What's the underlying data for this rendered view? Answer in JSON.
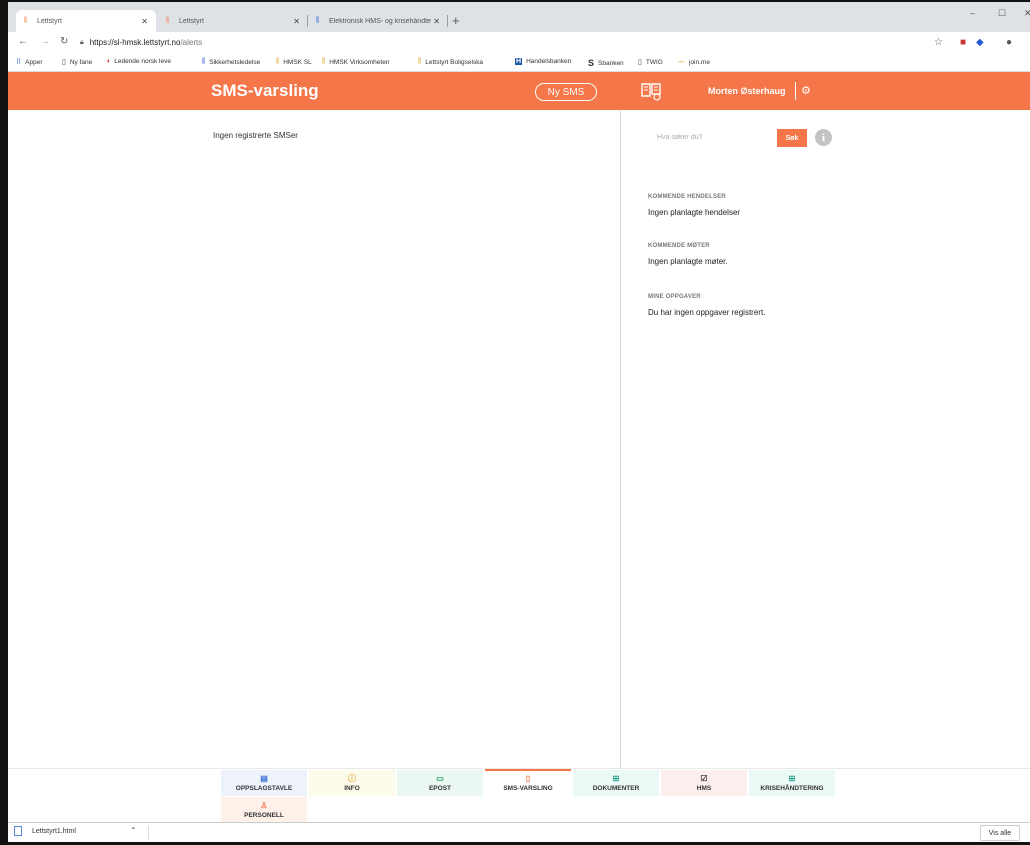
{
  "browser": {
    "tabs": [
      {
        "title": "Lettstyrt",
        "active": true
      },
      {
        "title": "Lettstyrt",
        "active": false
      },
      {
        "title": "Elektronisk HMS- og krisehåndte",
        "active": false
      }
    ],
    "new_tab": "+",
    "window_controls": {
      "minimize": "–",
      "maximize": "☐",
      "close": "✕"
    },
    "url_host": "https://sl-hmsk.lettstyrt.no",
    "url_path": "/alerts",
    "bookmarks": [
      {
        "label": "Apper",
        "icon": "apps-grid-icon"
      },
      {
        "label": "Ny fane",
        "icon": "page-icon"
      },
      {
        "label": "Ledende norsk leve",
        "icon": "lips-icon"
      },
      {
        "label": "Sikkerhetsledelse",
        "icon": "lettstyrt-icon"
      },
      {
        "label": "HMSK SL",
        "icon": "lettstyrt-icon"
      },
      {
        "label": "HMSK Virksomheten",
        "icon": "lettstyrt-icon"
      },
      {
        "label": "Lettstyrt Boligselska",
        "icon": "lettstyrt-icon"
      },
      {
        "label": "Handelsbanken",
        "icon": "handelsbanken-icon"
      },
      {
        "label": "Sbanken",
        "icon": "sbanken-icon"
      },
      {
        "label": "TWIG",
        "icon": "page-icon"
      },
      {
        "label": "join.me",
        "icon": "joinme-icon"
      }
    ]
  },
  "header": {
    "title": "SMS-varsling",
    "new_sms_label": "Ny SMS",
    "user_name": "Morten Østerhaug"
  },
  "main": {
    "empty_message": "Ingen registrerte SMSer"
  },
  "side": {
    "search_placeholder": "Hva søker du?",
    "search_button": "Søk",
    "info_glyph": "i",
    "sections": [
      {
        "title": "KOMMENDE HENDELSER",
        "text": "Ingen planlagte hendelser"
      },
      {
        "title": "KOMMENDE MØTER",
        "text": "Ingen planlagte møter."
      },
      {
        "title": "MINE OPPGAVER",
        "text": "Du har ingen oppgaver registrert."
      }
    ]
  },
  "bottom_nav": [
    {
      "label": "OPPSLAGSTAVLE",
      "icon": "board-icon",
      "bg": "#eef3fb",
      "color": "#3b6fd6"
    },
    {
      "label": "INFO",
      "icon": "info-circle-icon",
      "bg": "#fdfbec",
      "color": "#e0a92a"
    },
    {
      "label": "EPOST",
      "icon": "chat-icon",
      "bg": "#eaf8f1",
      "color": "#2a9d68"
    },
    {
      "label": "SMS-VARSLING",
      "icon": "phone-icon",
      "bg": "#ffffff",
      "color": "#f47649",
      "active": true
    },
    {
      "label": "DOKUMENTER",
      "icon": "documents-icon",
      "bg": "#eaf8f6",
      "color": "#2a9d90"
    },
    {
      "label": "HMS",
      "icon": "checklist-icon",
      "bg": "#fdeeee",
      "color": "#444444"
    },
    {
      "label": "KRISEHÅNDTERING",
      "icon": "crisis-icon",
      "bg": "#eaf8f6",
      "color": "#2a9d90"
    },
    {
      "label": "PERSONELL",
      "icon": "person-icon",
      "bg": "#fdf1ea",
      "color": "#f47649"
    }
  ],
  "download_bar": {
    "file_name": "Lettstyrt1.html",
    "show_all": "Vis alle"
  },
  "colors": {
    "brand": "#f47649"
  }
}
